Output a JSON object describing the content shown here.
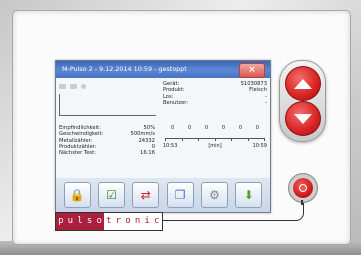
{
  "window": {
    "title": "M-Pulso 2 - 9.12.2014 10:59 - gestoppt",
    "close_label": "×"
  },
  "info": [
    {
      "label": "Gerät:",
      "value": "51030873"
    },
    {
      "label": "Produkt:",
      "value": "Fleisch"
    },
    {
      "label": "Los:",
      "value": "-"
    },
    {
      "label": "Benutzer:",
      "value": "-"
    }
  ],
  "stats": [
    {
      "label": "Empfindlichkeit:",
      "value": "50%"
    },
    {
      "label": "Geschwindigkeit:",
      "value": "500mm/s"
    },
    {
      "label": "Metallzähler:",
      "value": "24332"
    },
    {
      "label": "Produktzähler:",
      "value": "0"
    },
    {
      "label": "Nächster Test:",
      "value": "16:16"
    }
  ],
  "chart": {
    "counts": [
      "0",
      "0",
      "0",
      "0",
      "0",
      "0"
    ],
    "start_time": "10:53",
    "unit": "[min]",
    "end_time": "10:59"
  },
  "toolbar": {
    "buttons": [
      {
        "icon": "lock-icon",
        "glyph": "🔒"
      },
      {
        "icon": "checklist-icon",
        "glyph": "☑"
      },
      {
        "icon": "transfer-arrows-icon",
        "glyph": "⇄"
      },
      {
        "icon": "documents-icon",
        "glyph": "❐"
      },
      {
        "icon": "settings-gear-icon",
        "glyph": "⚙"
      },
      {
        "icon": "download-arrow-icon",
        "glyph": "⬇"
      }
    ]
  },
  "brand": {
    "logo_letters": [
      "p",
      "u",
      "l",
      "s",
      "o",
      "t",
      "r",
      "o",
      "n",
      "i",
      "c"
    ]
  },
  "colors": {
    "accent_red": "#d72222",
    "title_blue": "#4a74c3",
    "brand_red": "#a91f3d"
  }
}
